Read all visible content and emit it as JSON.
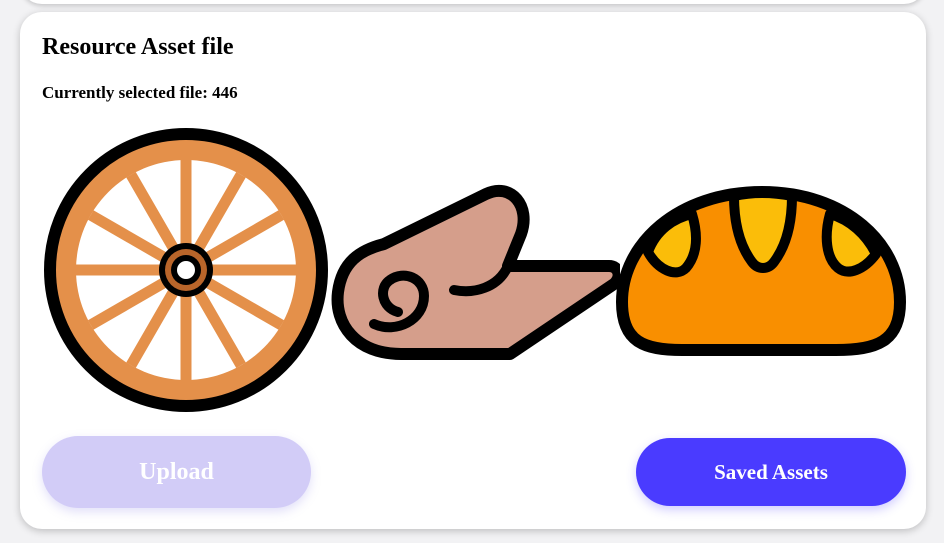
{
  "card": {
    "title": "Resource Asset file",
    "selected_file_label": "Currently selected file: 446"
  },
  "assets": [
    {
      "icon": "wagon-wheel-icon",
      "color": "#e4904a"
    },
    {
      "icon": "rolled-mat-icon",
      "color": "#d59e8b"
    },
    {
      "icon": "bread-loaf-icon",
      "color": "#f98f00"
    }
  ],
  "buttons": {
    "upload_label": "Upload",
    "saved_assets_label": "Saved Assets"
  },
  "colors": {
    "accent": "#4a3bff",
    "disabled_accent": "#d2ccf7"
  }
}
